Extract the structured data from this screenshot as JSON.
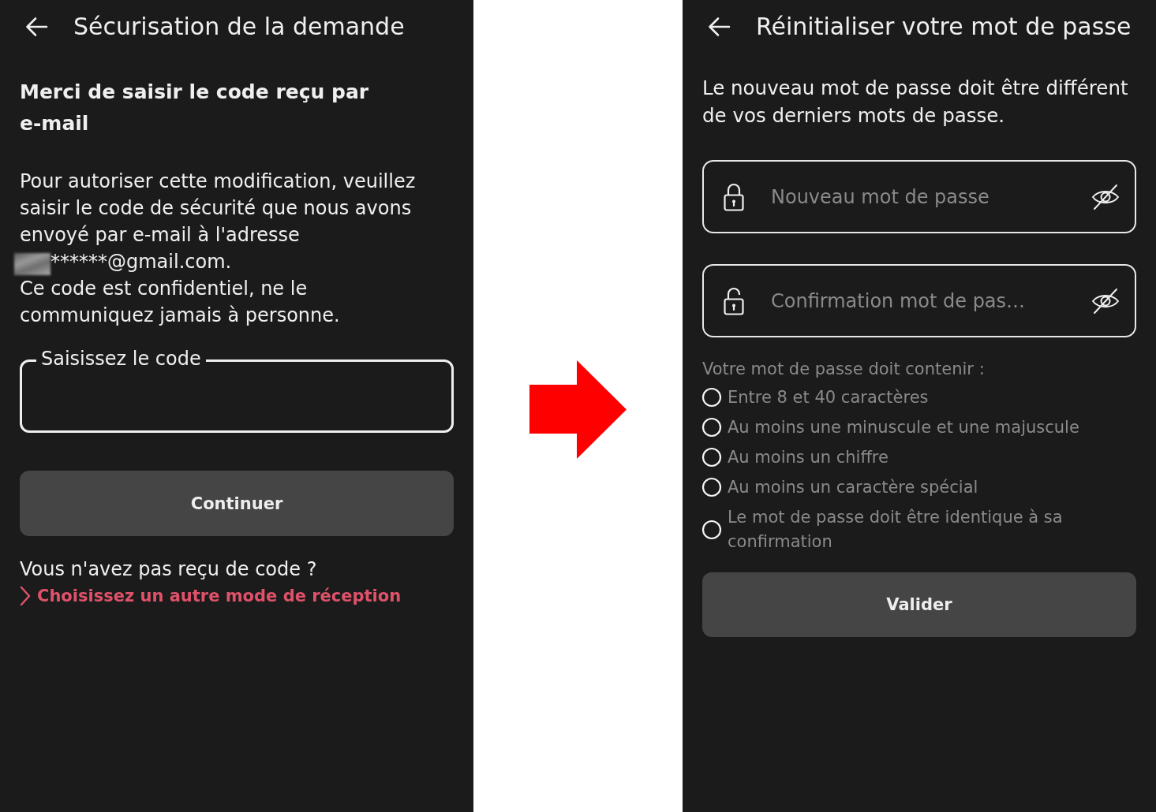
{
  "code_screen": {
    "header": {
      "title": "Sécurisation de la demande"
    },
    "heading": "Merci de saisir le code reçu par e-mail",
    "message": {
      "intro": "Pour autoriser cette modification, veuillez saisir le code de sécurité que nous avons envoyé par e-mail à l'adresse",
      "email": "******@gmail.com.",
      "warning": "Ce code est confidentiel, ne le communiquez jamais à personne."
    },
    "code_field": {
      "label": "Saisissez le code"
    },
    "continue_button": {
      "label": "Continuer"
    },
    "help": {
      "question": "Vous n'avez pas reçu de code ?",
      "link": "Choisissez un autre mode de réception"
    }
  },
  "reset_screen": {
    "header": {
      "title": "Réinitialiser votre mot de passe"
    },
    "description": "Le nouveau mot de passe doit être différent de vos derniers mots de passe.",
    "fields": [
      {
        "kind": "new",
        "placeholder": "Nouveau mot de passe",
        "visible": false
      },
      {
        "kind": "confirm",
        "placeholder": "Confirmation mot de pas…",
        "visible": false
      }
    ],
    "requirements": {
      "title": "Votre mot de passe doit contenir :",
      "items": [
        {
          "label": "Entre 8 et 40 caractères",
          "checked": false
        },
        {
          "label": "Au moins une minuscule et une majuscule",
          "checked": false
        },
        {
          "label": "Au moins un chiffre",
          "checked": false
        },
        {
          "label": "Au moins un caractère spécial",
          "checked": false
        },
        {
          "label": "Le mot de passe doit être identique à sa confirmation",
          "checked": false
        }
      ]
    },
    "submit_button": {
      "label": "Valider"
    }
  }
}
